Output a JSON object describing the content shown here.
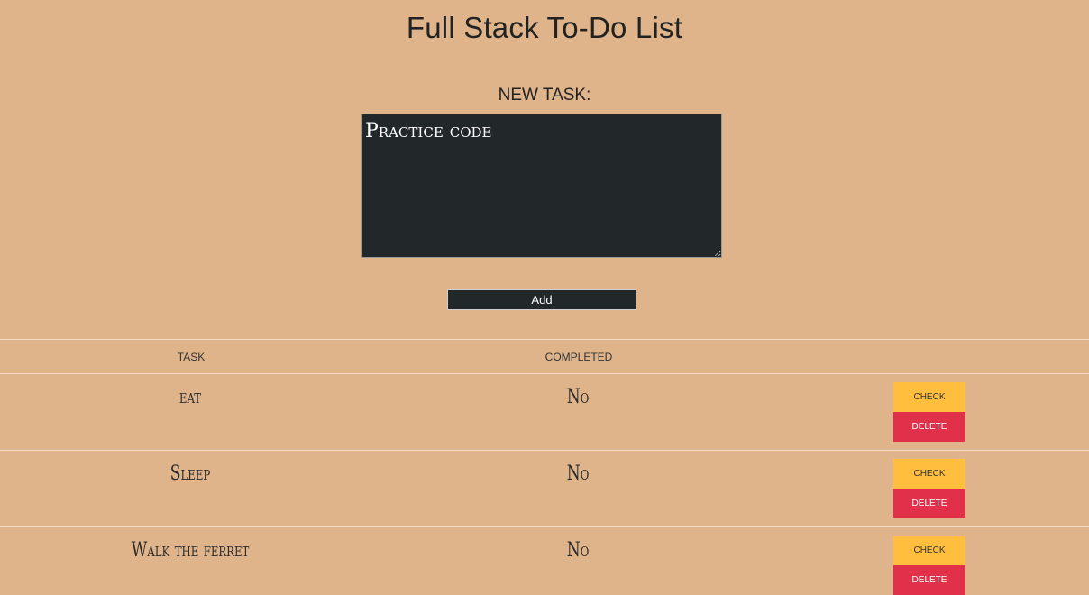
{
  "page": {
    "title": "Full Stack To-Do List"
  },
  "form": {
    "label": "NEW TASK:",
    "textarea_value": "Practice code",
    "add_label": "Add"
  },
  "table": {
    "headers": {
      "task": "TASK",
      "completed": "COMPLETED"
    },
    "rows": [
      {
        "task": "eat",
        "completed": "No",
        "check_label": "CHECK",
        "delete_label": "DELETE"
      },
      {
        "task": "Sleep",
        "completed": "No",
        "check_label": "CHECK",
        "delete_label": "DELETE"
      },
      {
        "task": "Walk the ferret",
        "completed": "No",
        "check_label": "CHECK",
        "delete_label": "DELETE"
      }
    ]
  },
  "colors": {
    "background": "#dfb48a",
    "dark": "#222729",
    "check": "#ffbe3d",
    "delete": "#e0304a"
  }
}
